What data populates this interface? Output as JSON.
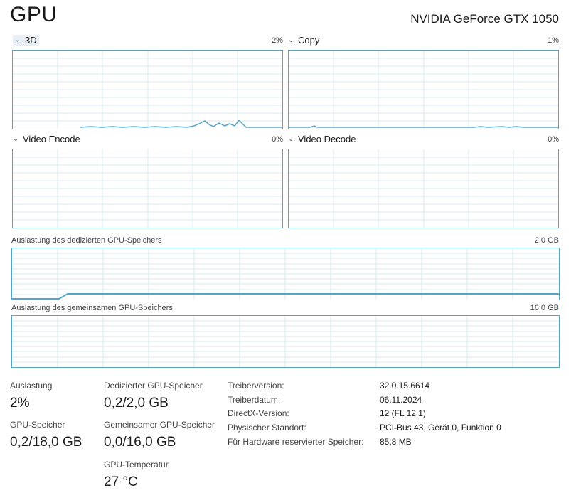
{
  "header": {
    "title": "GPU",
    "model": "NVIDIA GeForce GTX 1050"
  },
  "engines": {
    "threeD": {
      "label": "3D",
      "value": "2%"
    },
    "copy": {
      "label": "Copy",
      "value": "1%"
    },
    "video_encode": {
      "label": "Video Encode",
      "value": "0%"
    },
    "video_decode": {
      "label": "Video Decode",
      "value": "0%"
    }
  },
  "memory": {
    "dedicated": {
      "label": "Auslastung des dedizierten GPU-Speichers",
      "max": "2,0 GB"
    },
    "shared": {
      "label": "Auslastung des gemeinsamen GPU-Speichers",
      "max": "16,0 GB"
    }
  },
  "stats": {
    "utilization": {
      "label": "Auslastung",
      "value": "2%"
    },
    "dedicated_mem": {
      "label": "Dedizierter GPU-Speicher",
      "value": "0,2/2,0 GB"
    },
    "gpu_mem": {
      "label": "GPU-Speicher",
      "value": "0,2/18,0 GB"
    },
    "shared_mem": {
      "label": "Gemeinsamer GPU-Speicher",
      "value": "0,0/16,0 GB"
    },
    "temperature": {
      "label": "GPU-Temperatur",
      "value": "27 °C"
    }
  },
  "info": {
    "driver_version": {
      "label": "Treiberversion:",
      "value": "32.0.15.6614"
    },
    "driver_date": {
      "label": "Treiberdatum:",
      "value": "06.11.2024"
    },
    "directx": {
      "label": "DirectX-Version:",
      "value": "12 (FL 12.1)"
    },
    "location": {
      "label": "Physischer Standort:",
      "value": "PCI-Bus 43, Gerät 0, Funktion 0"
    },
    "reserved": {
      "label": "Für Hardware reservierter Speicher:",
      "value": "85,8 MB"
    }
  },
  "colors": {
    "line": "#58a4c6",
    "grid": "#d9e9f1",
    "border": "#58a4c6",
    "selected_tab": "#e8eff7"
  }
}
